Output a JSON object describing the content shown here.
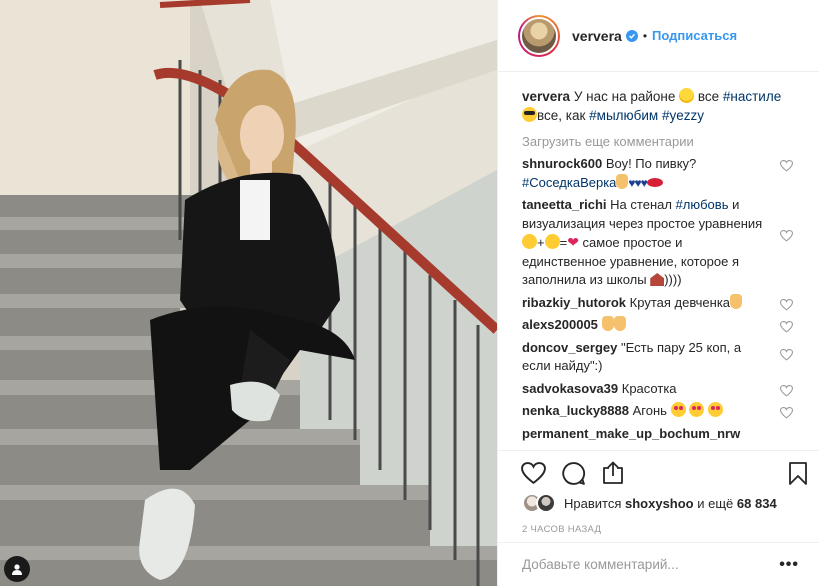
{
  "post": {
    "author": "ververa",
    "dot": "•",
    "follow_label": "Подписаться",
    "caption": {
      "username": "ververa",
      "text_1": "У нас на районе ",
      "text_2": " все ",
      "tag_1": "#настиле",
      "text_3": "все, как ",
      "tag_2": "#мылюбим",
      "tag_3": "#yezzy"
    },
    "load_more": "Загрузить еще комментарии",
    "comments": [
      {
        "username": "shnurock600",
        "text": "Воу! По пивку?",
        "tag": "#СоседкаВерка"
      },
      {
        "username": "taneetta_richi",
        "text_a": "На стенал ",
        "tag": "#любовь",
        "text_b": " и визуализация через простое уравнения ",
        "text_c": " самое простое и единственное уравнение, которое я заполнила из школы ",
        "text_d": "))))"
      },
      {
        "username": "ribazkiy_hutorok",
        "text": "Крутая девченка"
      },
      {
        "username": "alexs200005",
        "text": ""
      },
      {
        "username": "doncov_sergey",
        "text": "\"Есть пару 25 коп, а если найду\":)"
      },
      {
        "username": "sadvokasova39",
        "text": "Красотка"
      },
      {
        "username": "nenka_lucky8888",
        "text": "Агонь "
      },
      {
        "username": "permanent_make_up_bochum_nrw",
        "text": ""
      }
    ],
    "likes": {
      "prefix": "Нравится",
      "user": "shoxyshoo",
      "middle": "и ещё",
      "count": "68 834"
    },
    "time": "2 часов назад",
    "add_comment_placeholder": "Добавьте комментарий...",
    "more_label": "•••"
  },
  "icons": {
    "verified": "verified-badge-icon",
    "like": "heart-icon",
    "comment": "comment-icon",
    "share": "share-icon",
    "save": "bookmark-icon"
  },
  "colors": {
    "accent": "#3897f0",
    "hashtag": "#003569",
    "muted": "#999999",
    "text": "#262626"
  }
}
